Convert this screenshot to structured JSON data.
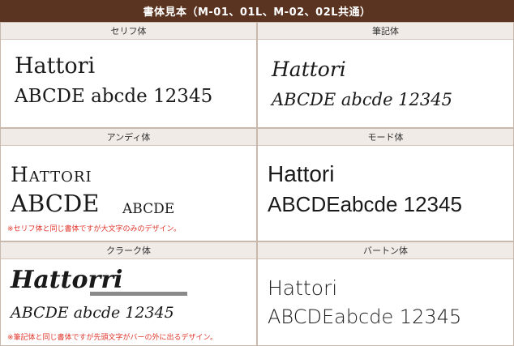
{
  "title": "書体見本（M-01、01L、M-02、02L共通）",
  "styles": [
    {
      "name": "セリフ体",
      "line1": "Hattori",
      "line2": "ABCDE abcde 12345"
    },
    {
      "name": "筆記体",
      "line1": "Hattori",
      "line2": "ABCDE abcde 12345"
    },
    {
      "name": "アンディ体",
      "line1": "Hattori",
      "line2a": "ABCDE",
      "line2b": "abcde",
      "note": "※セリフ体と同じ書体ですが大文字のみのデザイン。"
    },
    {
      "name": "モード体",
      "line1": "Hattori",
      "line2": "ABCDEabcde 12345"
    },
    {
      "name": "クラーク体",
      "line1": "Hattorri",
      "line2": "ABCDE abcde 12345",
      "note": "※筆記体と同じ書体ですが先頭文字がバーの外に出るデザイン。"
    },
    {
      "name": "バートン体",
      "line1": "Hattori",
      "line2": "ABCDEabcde 12345"
    }
  ],
  "colors": {
    "title_bg": "#5b3421",
    "header_bg": "#f1ebe7",
    "border": "#c9b8ac",
    "note": "#e0362b"
  }
}
